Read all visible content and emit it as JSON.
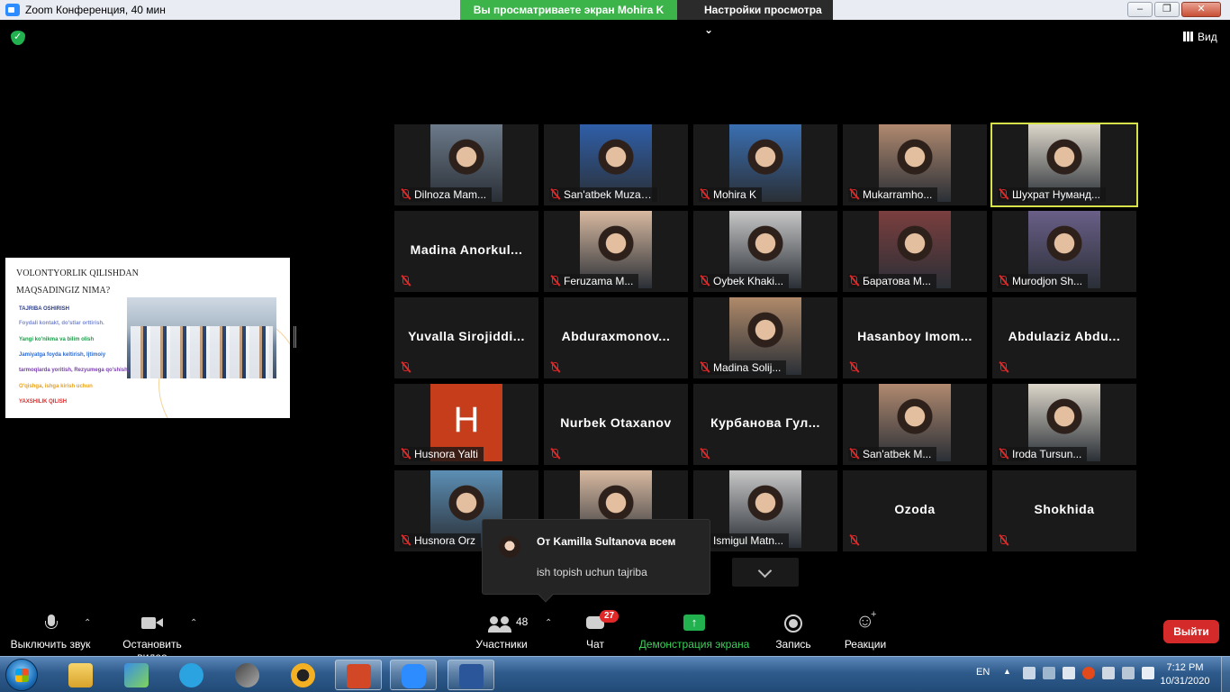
{
  "window": {
    "title": "Zoom Конференция, 40 мин"
  },
  "banner": {
    "sharing_text": "Вы просматриваете экран Mohira K",
    "view_options": "Настройки просмотра"
  },
  "topbar": {
    "view_label": "Вид"
  },
  "shared_slide": {
    "title_line1": "VOLONTYORLIK QILISHDAN",
    "title_line2": "MAQSADINGIZ NIMA?",
    "lines": [
      {
        "text": "TAJRIBA OSHIRISH",
        "color": "#2a3d8f"
      },
      {
        "text": "Foydali kontakt, do'stlar orttirish.",
        "color": "#7b8bd1"
      },
      {
        "text": "Yangi ko'nikma va bilim olish",
        "color": "#1e9a4a"
      },
      {
        "text": "Jamiyatga foyda keltirish,  Ijtimoiy",
        "color": "#2b6bd6"
      },
      {
        "text": "tarmoqlarda yoritish, Rezyumega qo'shish,",
        "color": "#7a3fb0"
      },
      {
        "text": "O'qishga, ishga kirish uchun",
        "color": "#e8a21f"
      },
      {
        "text": "YAXSHILIK QILISH",
        "color": "#e02828"
      }
    ]
  },
  "participants": [
    {
      "label": "Dilnoza Mam...",
      "video": true,
      "big": false
    },
    {
      "label": "San'atbek Muzaf...",
      "video": true,
      "big": false
    },
    {
      "label": "Mohira K",
      "video": true,
      "big": false
    },
    {
      "label": "Mukarramho...",
      "video": true,
      "big": false
    },
    {
      "label": "Шухрат Нуманд...",
      "video": true,
      "big": false,
      "active": true
    },
    {
      "label": "Madina  Anorkul...",
      "video": false,
      "big": true
    },
    {
      "label": "Feruzama M...",
      "video": true,
      "big": false
    },
    {
      "label": "Oybek Khaki...",
      "video": true,
      "big": false
    },
    {
      "label": "Баратова М...",
      "video": true,
      "big": false
    },
    {
      "label": "Murodjon Sh...",
      "video": true,
      "big": false
    },
    {
      "label": "Yuvalla  Sirojiddi...",
      "video": false,
      "big": true
    },
    {
      "label": "Abduraxmonov...",
      "video": false,
      "big": true
    },
    {
      "label": "Madina Solij...",
      "video": true,
      "big": false
    },
    {
      "label": "Hasanboy  Imom...",
      "video": false,
      "big": true
    },
    {
      "label": "Abdulaziz  Abdu...",
      "video": false,
      "big": true
    },
    {
      "label": "Husnora Yalti",
      "video": true,
      "big": false,
      "avatar_letter": "H"
    },
    {
      "label": "Nurbek Otaxanov",
      "video": false,
      "big": true
    },
    {
      "label": "Курбанова  Гул...",
      "video": false,
      "big": true
    },
    {
      "label": "San'atbek M...",
      "video": true,
      "big": false
    },
    {
      "label": "Iroda Tursun...",
      "video": true,
      "big": false
    },
    {
      "label": "Husnora Orz",
      "video": true,
      "big": false
    },
    {
      "label": "",
      "video": true,
      "big": false
    },
    {
      "label": "Ismigul Matn...",
      "video": true,
      "big": false
    },
    {
      "label": "Ozoda",
      "video": false,
      "big": true
    },
    {
      "label": "Shokhida",
      "video": false,
      "big": true
    }
  ],
  "chat_toast": {
    "from": "От Kamilla Sultanova всем",
    "message": "ish topish uchun tajriba"
  },
  "toolbar": {
    "mute": "Выключить звук",
    "stop_video": "Остановить видео",
    "participants": "Участники",
    "participants_count": "48",
    "chat": "Чат",
    "chat_badge": "27",
    "share": "Демонстрация экрана",
    "record": "Запись",
    "reactions": "Реакции",
    "leave": "Выйти"
  },
  "taskbar": {
    "lang": "EN",
    "time": "7:12 PM",
    "date": "10/31/2020"
  },
  "colors": {
    "accent": "#2d8cff",
    "share_green": "#3cb44a",
    "leave_red": "#d52a2a",
    "active_speaker": "#d7e24b"
  }
}
